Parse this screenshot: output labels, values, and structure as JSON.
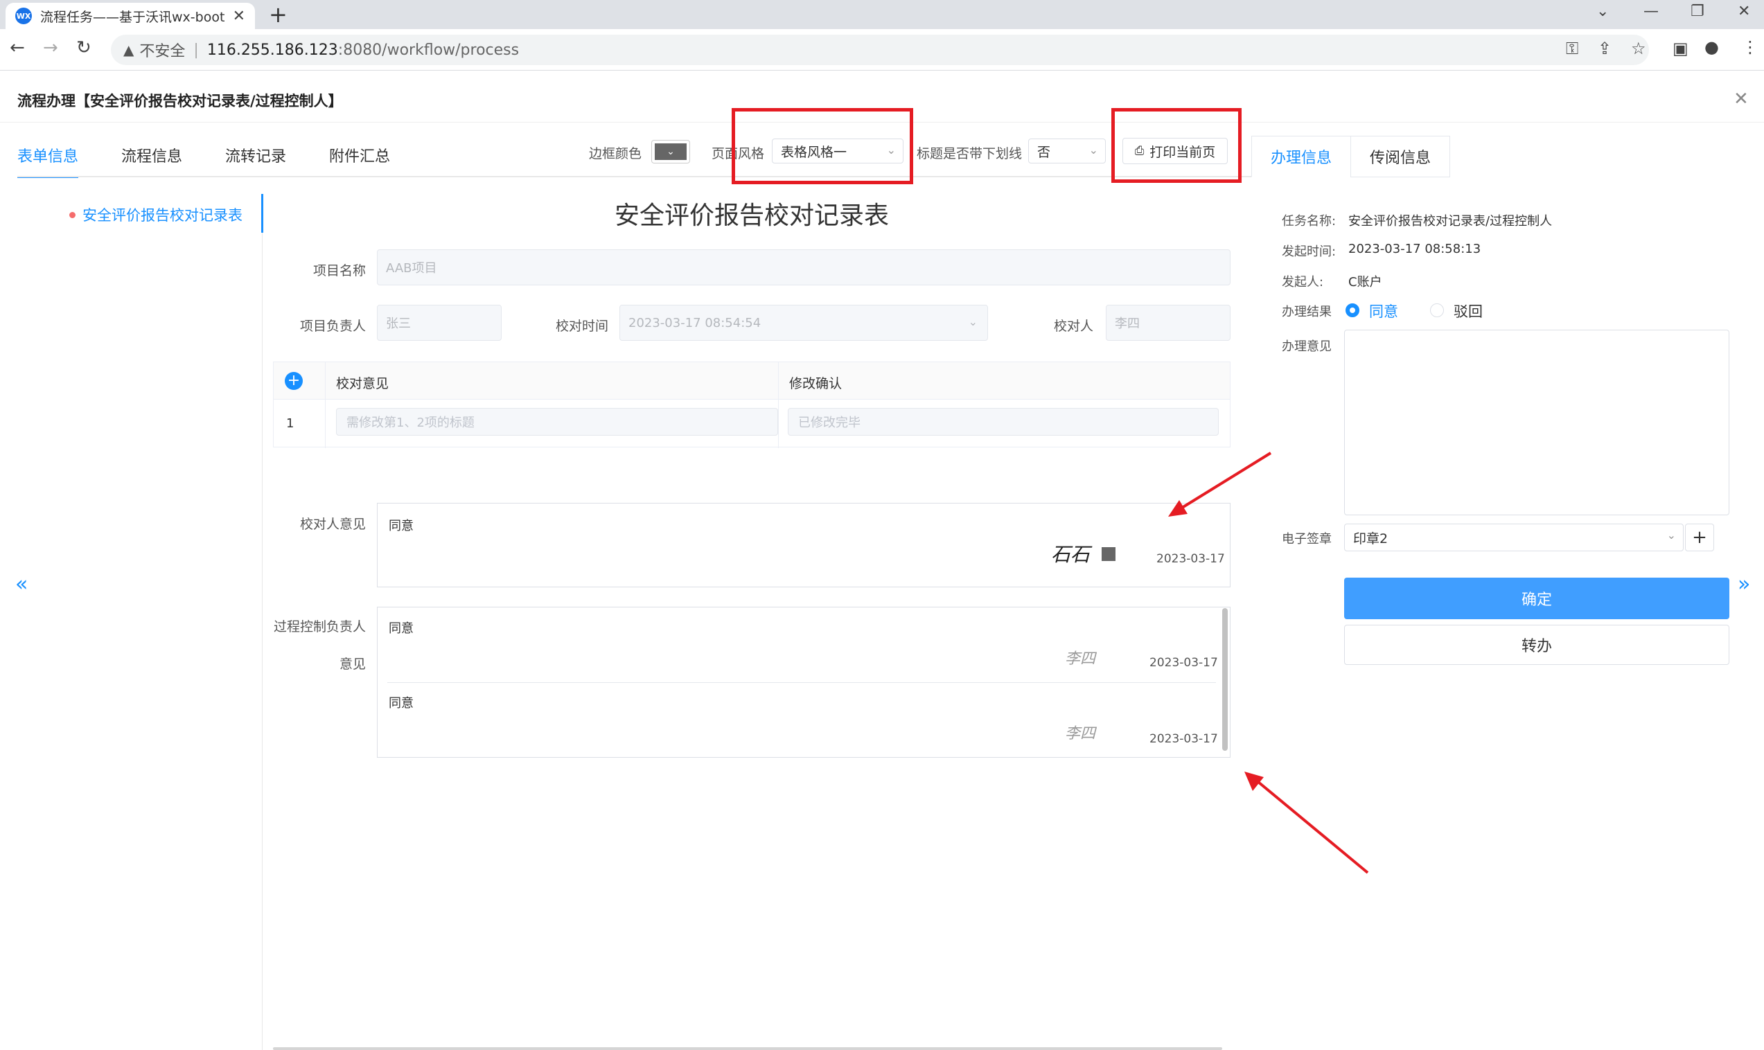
{
  "browser": {
    "tab_title": "流程任务——基于沃讯wx-boot",
    "favicon_text": "WX",
    "insecure_label": "不安全",
    "url_host": "116.255.186.123",
    "url_path": ":8080/workflow/process"
  },
  "header": {
    "title": "流程办理【安全评价报告校对记录表/过程控制人】"
  },
  "left_tabs": [
    "表单信息",
    "流程信息",
    "流转记录",
    "附件汇总"
  ],
  "toolbar": {
    "border_color_label": "边框颜色",
    "page_style_label": "页面风格",
    "page_style_value": "表格风格一",
    "underline_label": "标题是否带下划线",
    "underline_value": "否",
    "print_label": "打印当前页"
  },
  "right_tabs": [
    "办理信息",
    "传阅信息"
  ],
  "tree": {
    "item": "安全评价报告校对记录表"
  },
  "form": {
    "title": "安全评价报告校对记录表",
    "project_name_label": "项目名称",
    "project_name_value": "AAB项目",
    "owner_label": "项目负责人",
    "owner_value": "张三",
    "check_time_label": "校对时间",
    "check_time_value": "2023-03-17 08:54:54",
    "checker_label": "校对人",
    "checker_value": "李四",
    "grid": {
      "headers": [
        "校对意见",
        "修改确认"
      ],
      "rows": [
        {
          "index": "1",
          "opinion": "需修改第1、2项的标题",
          "confirm": "已修改完毕"
        }
      ]
    },
    "checker_opinion_label": "校对人意见",
    "checker_opinion": {
      "text": "同意",
      "signature": "石石",
      "date": "2023-03-17"
    },
    "process_opinion_label_1": "过程控制负责人",
    "process_opinion_label_2": "意见",
    "process_opinions": [
      {
        "text": "同意",
        "signature": "李四",
        "date": "2023-03-17"
      },
      {
        "text": "同意",
        "signature": "李四",
        "date": "2023-03-17"
      }
    ]
  },
  "handle": {
    "task_name_label": "任务名称:",
    "task_name_value": "安全评价报告校对记录表/过程控制人",
    "start_time_label": "发起时间:",
    "start_time_value": "2023-03-17 08:58:13",
    "initiator_label": "发起人:",
    "initiator_value": "C账户",
    "result_label": "办理结果",
    "result_agree": "同意",
    "result_reject": "驳回",
    "opinion_label": "办理意见",
    "seal_label": "电子签章",
    "seal_value": "印章2",
    "confirm_button": "确定",
    "transfer_button": "转办"
  },
  "colors": {
    "accent": "#1890ff",
    "highlight": "#e51c23",
    "primary_button": "#409eff"
  }
}
